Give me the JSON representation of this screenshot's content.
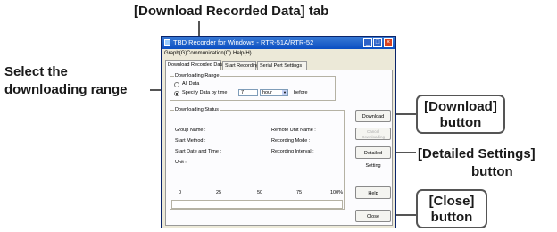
{
  "callouts": {
    "tab": "[Download Recorded Data] tab",
    "range_line1": "Select the",
    "range_line2": "downloading range",
    "download_line1": "[Download]",
    "download_line2": "button",
    "detailed_line1": "[Detailed Settings]",
    "detailed_line2": "button",
    "close_line1": "[Close]",
    "close_line2": "button"
  },
  "window": {
    "title": "TBD Recorder for Windows - RTR-51A/RTR-52",
    "menu": [
      "Graph(G)",
      "Communication(C)",
      "Help(H)"
    ],
    "tabs": [
      "Download Recorded Data",
      "Start Recording",
      "Serial Port Settings"
    ],
    "range": {
      "title": "Downloading Range",
      "all_data": "All Data",
      "specify": "Specify Data by time",
      "value": "7",
      "unit": "hour",
      "suffix": "before"
    },
    "status": {
      "title": "Downloading Status",
      "group_name": "Group Name :",
      "remote_unit_name": "Remote Unit Name :",
      "start_method": "Start Method :",
      "recording_mode": "Recording Mode :",
      "start_datetime": "Start Date and Time :",
      "recording_interval": "Recording Interval :",
      "unit": "Unit :",
      "scale": [
        "0",
        "25",
        "50",
        "75",
        "100%"
      ]
    },
    "buttons": {
      "download": "Download",
      "cancel_line1": "Cancel",
      "cancel_line2": "Downloading",
      "detailed": "Detailed Setting",
      "help": "Help",
      "close": "Close"
    },
    "progress": 0
  }
}
